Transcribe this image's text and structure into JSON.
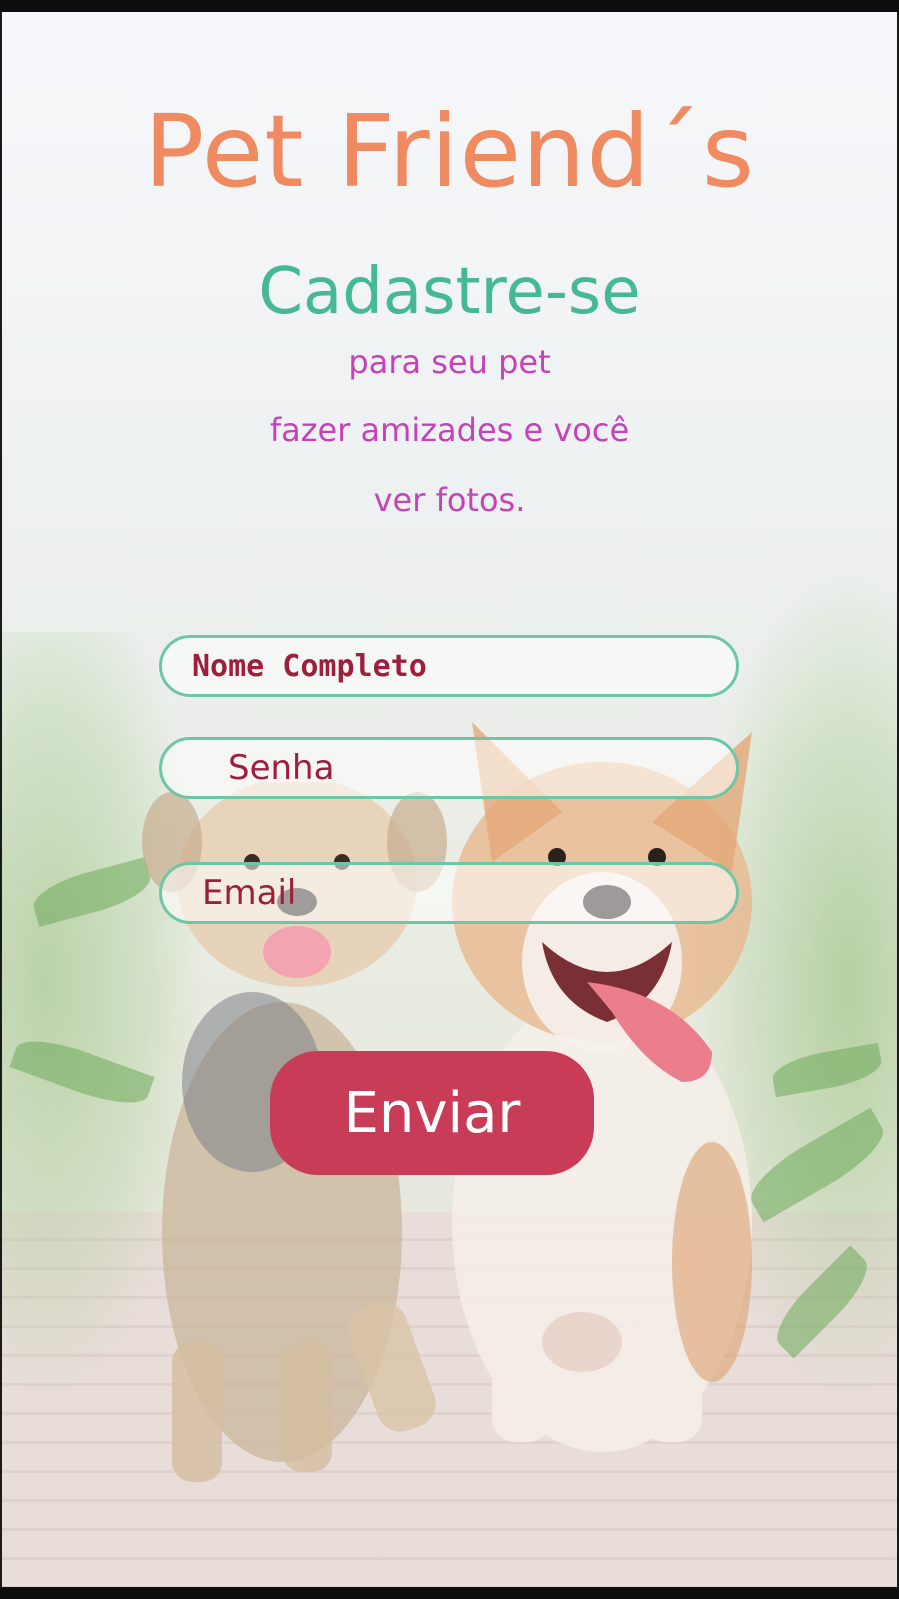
{
  "header": {
    "title": "Pet Friend´s",
    "subtitle": "Cadastre-se",
    "tagline": [
      "para seu pet",
      "fazer amizades e você",
      "ver fotos."
    ]
  },
  "form": {
    "name_placeholder": "Nome Completo",
    "password_placeholder": "Senha",
    "email_placeholder": "Email",
    "submit_label": "Enviar"
  },
  "background": {
    "image_subject": "two dogs running on a path",
    "icons": [
      "corgi-dog-illustration",
      "terrier-dog-illustration"
    ]
  },
  "colors": {
    "title": "#ef8a61",
    "subtitle": "#45b896",
    "tagline": "#c443b8",
    "field_border": "#6dc7a6",
    "field_text": "#9e1f3c",
    "button": "#c83c57"
  }
}
